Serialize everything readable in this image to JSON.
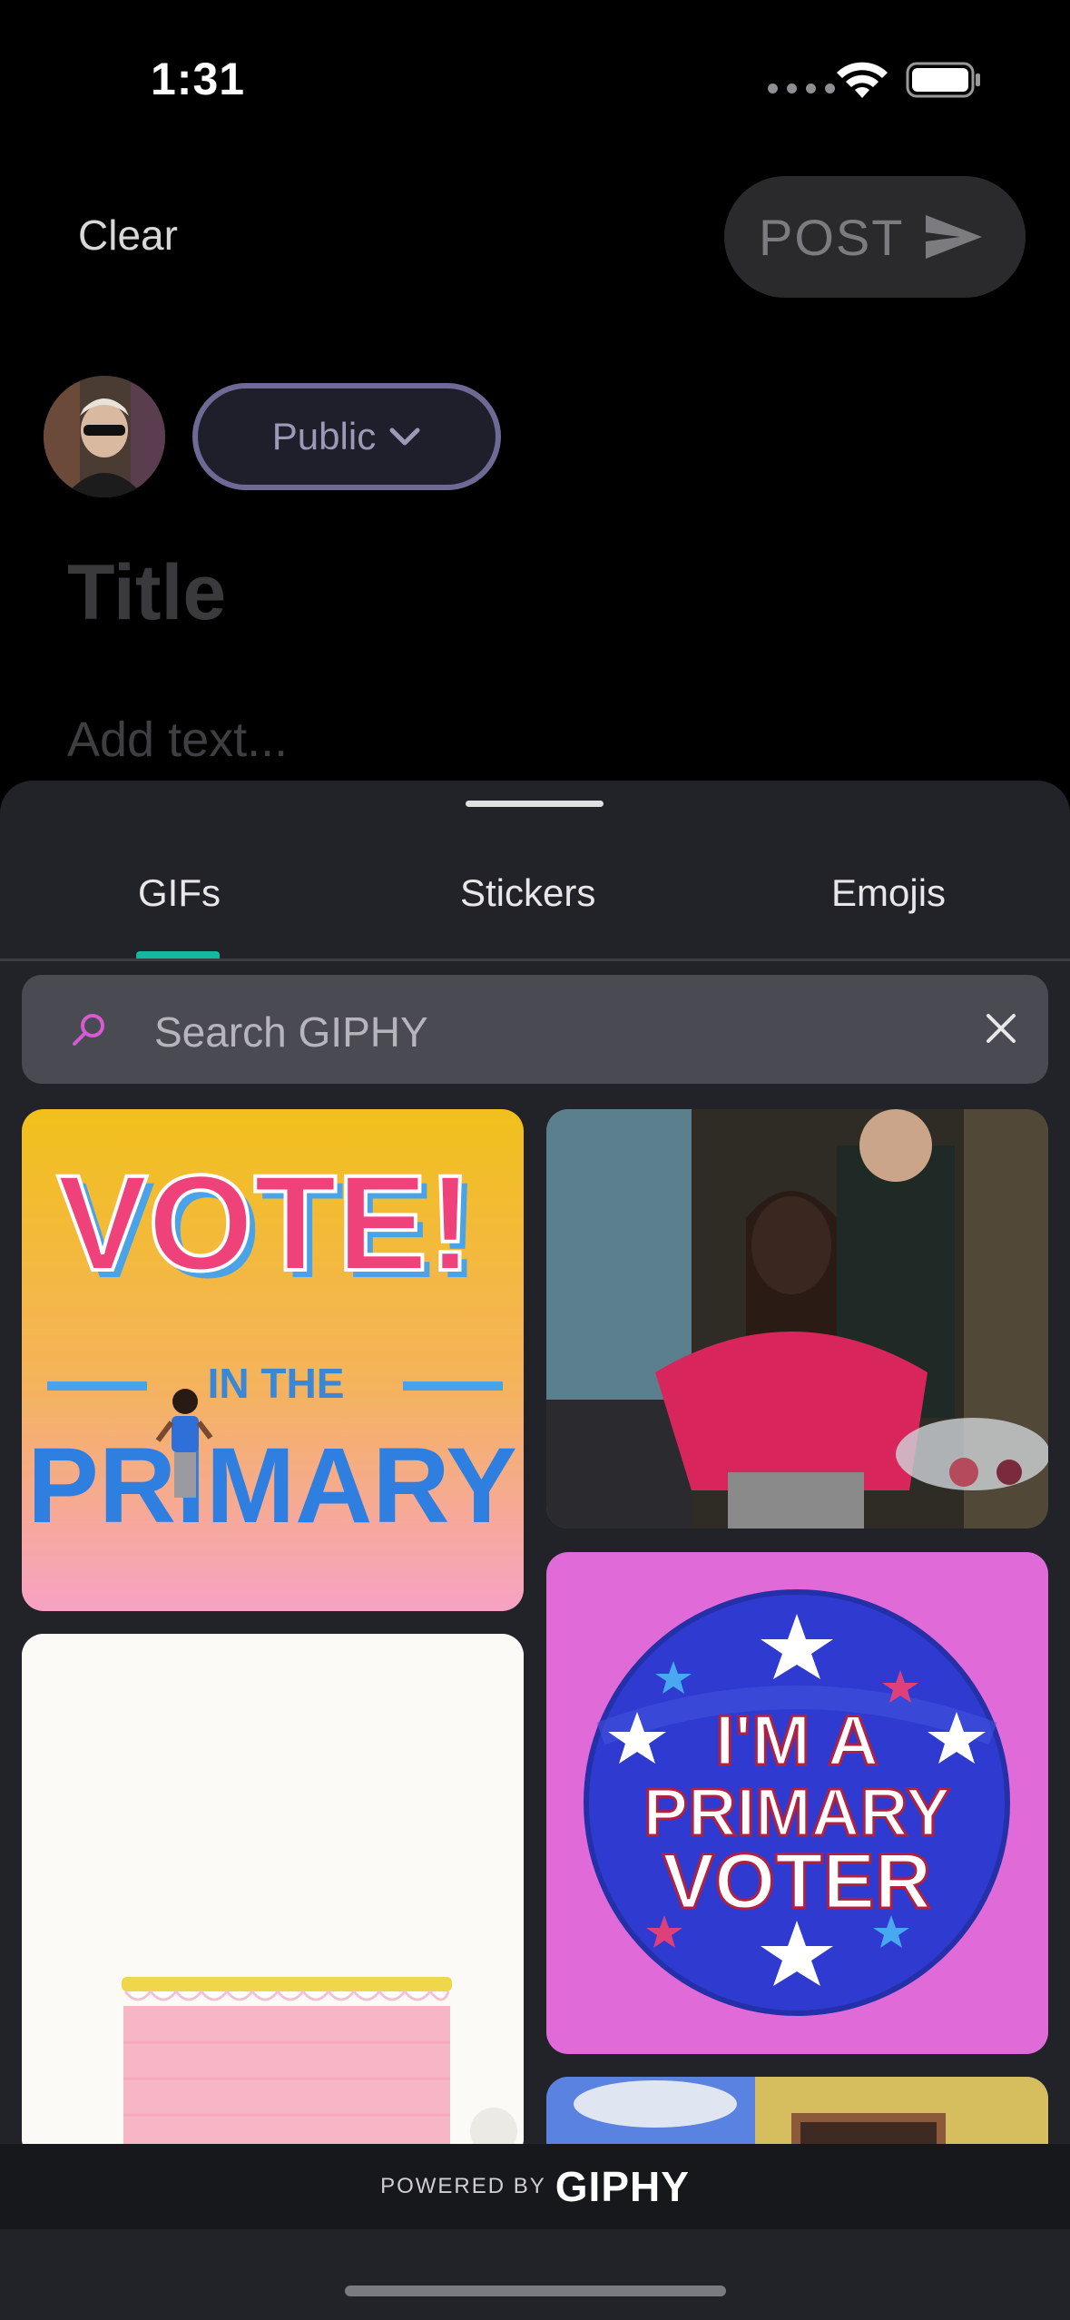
{
  "status_bar": {
    "time": "1:31"
  },
  "composer": {
    "clear_label": "Clear",
    "post_label": "POST",
    "visibility_label": "Public",
    "title_placeholder": "Title",
    "body_placeholder": "Add text..."
  },
  "gif_picker": {
    "tabs": [
      {
        "label": "GIFs",
        "selected": true
      },
      {
        "label": "Stickers",
        "selected": false
      },
      {
        "label": "Emojis",
        "selected": false
      }
    ],
    "accent_color": "#12b99f",
    "search_placeholder": "Search GIPHY",
    "results": [
      {
        "name": "gif-vote-in-the-primary",
        "text": [
          "VOTE!",
          "IN THE",
          "PRIMARY"
        ]
      },
      {
        "name": "gif-party-celebration"
      },
      {
        "name": "gif-im-a-primary-voter",
        "text": [
          "I'M A",
          "PRIMARY",
          "VOTER"
        ]
      },
      {
        "name": "gif-pink-cake"
      },
      {
        "name": "gif-cartoon-scene"
      }
    ],
    "footer": {
      "powered_by": "POWERED BY",
      "brand": "GIPHY"
    }
  }
}
